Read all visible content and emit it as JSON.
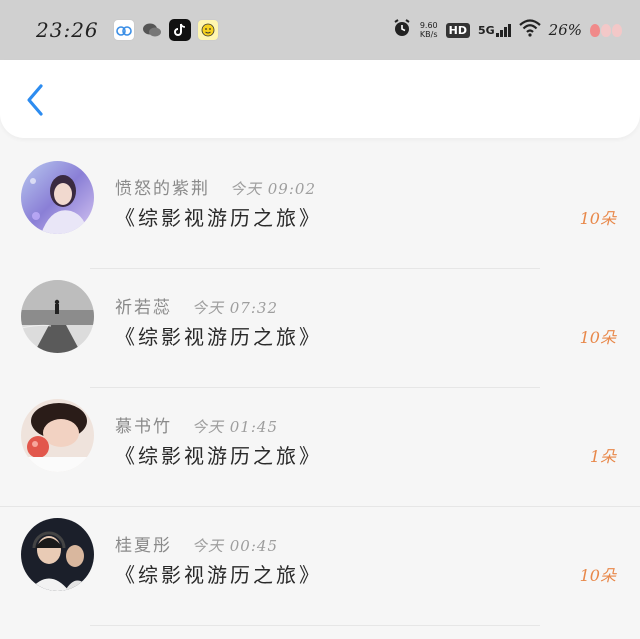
{
  "status_bar": {
    "time": "23:26",
    "net_speed_value": "9.60",
    "net_speed_unit": "KB/s",
    "hd_label": "HD",
    "network_label": "5G",
    "battery": "26%"
  },
  "header": {
    "back_icon": "chevron-left-icon"
  },
  "items": [
    {
      "username": "愤怒的紫荆",
      "time": "今天 09:02",
      "title": "《综影视游历之旅》",
      "reward": "10朵"
    },
    {
      "username": "祈若蕊",
      "time": "今天 07:32",
      "title": "《综影视游历之旅》",
      "reward": "10朵"
    },
    {
      "username": "慕书竹",
      "time": "今天 01:45",
      "title": "《综影视游历之旅》",
      "reward": "1朵"
    },
    {
      "username": "桂夏彤",
      "time": "今天 00:45",
      "title": "《综影视游历之旅》",
      "reward": "10朵"
    }
  ],
  "colors": {
    "accent_blue": "#2d8cf0",
    "reward_orange": "#e8884a"
  }
}
